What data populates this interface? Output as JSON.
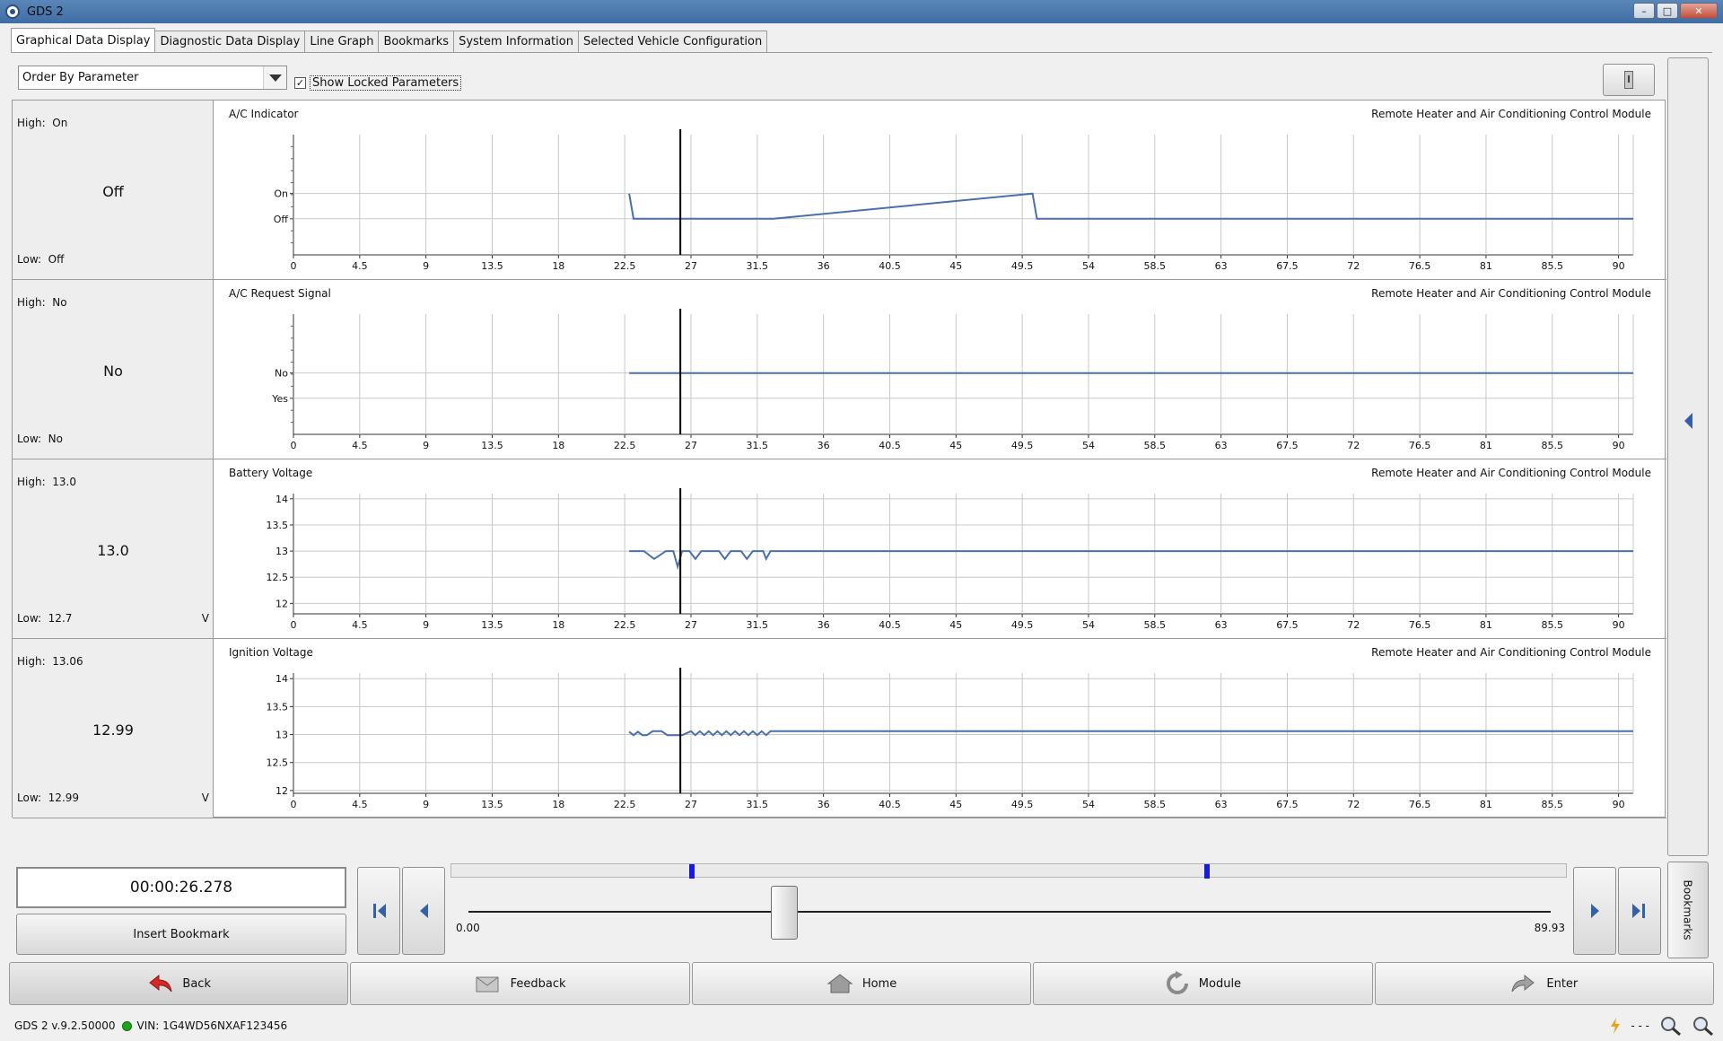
{
  "window": {
    "title": "GDS 2"
  },
  "tabs": [
    {
      "label": "Graphical Data Display",
      "active": true
    },
    {
      "label": "Diagnostic Data Display",
      "active": false
    },
    {
      "label": "Line Graph",
      "active": false
    },
    {
      "label": "Bookmarks",
      "active": false
    },
    {
      "label": "System Information",
      "active": false
    },
    {
      "label": "Selected Vehicle Configuration",
      "active": false
    }
  ],
  "toolbar": {
    "order_select": "Order By Parameter",
    "show_locked_checked": true,
    "show_locked_label": "Show Locked Parameters"
  },
  "x_axis": {
    "ticks": [
      "0",
      "4.5",
      "9",
      "13.5",
      "18",
      "22.5",
      "27",
      "31.5",
      "36",
      "40.5",
      "45",
      "49.5",
      "54",
      "58.5",
      "63",
      "67.5",
      "72",
      "76.5",
      "81",
      "85.5",
      "90"
    ],
    "min": 0,
    "max": 91,
    "cursor": 26.278
  },
  "rows": [
    {
      "name": "A/C Indicator",
      "module": "Remote Heater and Air Conditioning Control Module",
      "high_label": "High:",
      "high": "On",
      "current": "Off",
      "low_label": "Low:",
      "low": "Off",
      "unit": ""
    },
    {
      "name": "A/C Request Signal",
      "module": "Remote Heater and Air Conditioning Control Module",
      "high_label": "High:",
      "high": "No",
      "current": "No",
      "low_label": "Low:",
      "low": "No",
      "unit": ""
    },
    {
      "name": "Battery Voltage",
      "module": "Remote Heater and Air Conditioning Control Module",
      "high_label": "High:",
      "high": "13.0",
      "current": "13.0",
      "low_label": "Low:",
      "low": "12.7",
      "unit": "V"
    },
    {
      "name": "Ignition Voltage",
      "module": "Remote Heater and Air Conditioning Control Module",
      "high_label": "High:",
      "high": "13.06",
      "current": "12.99",
      "low_label": "Low:",
      "low": "12.99",
      "unit": "V"
    }
  ],
  "chart_data": [
    {
      "type": "line",
      "title": "A/C Indicator",
      "y_categories": [
        "On",
        "Off"
      ],
      "series": [
        {
          "color": "#4a6fae",
          "x": [
            22.8,
            23.1,
            32.6,
            50.2,
            50.5,
            91
          ],
          "y": [
            "On",
            "Off",
            "Off",
            "On",
            "Off",
            "Off"
          ]
        }
      ],
      "grid": true
    },
    {
      "type": "line",
      "title": "A/C Request Signal",
      "y_categories": [
        "No",
        "Yes"
      ],
      "series": [
        {
          "color": "#4a6fae",
          "x": [
            22.8,
            91
          ],
          "y": [
            "No",
            "No"
          ]
        }
      ],
      "grid": true
    },
    {
      "type": "line",
      "title": "Battery Voltage",
      "ylim": [
        11.8,
        14.1
      ],
      "y_ticks": [
        "14",
        "13.5",
        "13",
        "12.5",
        "12"
      ],
      "series": [
        {
          "color": "#4a6fae",
          "x": [
            22.8,
            23.8,
            24.5,
            25.3,
            25.8,
            26.1,
            26.4,
            26.9,
            27.3,
            27.7,
            28.9,
            29.3,
            29.7,
            30.4,
            30.8,
            31.2,
            31.9,
            32.1,
            32.4,
            91
          ],
          "y": [
            13,
            13,
            12.85,
            13,
            13,
            12.7,
            13,
            13,
            12.85,
            13,
            13,
            12.85,
            13,
            13,
            12.85,
            13,
            13,
            12.85,
            13,
            13
          ]
        }
      ],
      "grid": true
    },
    {
      "type": "line",
      "title": "Ignition Voltage",
      "ylim": [
        11.95,
        14.1
      ],
      "y_ticks": [
        "14",
        "13.5",
        "13",
        "12.5",
        "12"
      ],
      "series": [
        {
          "color": "#4a6fae",
          "x": [
            22.8,
            23.1,
            23.4,
            23.7,
            24.0,
            24.4,
            25.0,
            25.4,
            25.8,
            26.4,
            27.0,
            27.3,
            27.6,
            27.9,
            28.2,
            28.5,
            28.8,
            29.1,
            29.4,
            29.7,
            30.0,
            30.3,
            30.6,
            30.9,
            31.2,
            31.5,
            31.8,
            32.1,
            32.4,
            91
          ],
          "y": [
            13.05,
            12.99,
            13.05,
            12.99,
            12.99,
            13.06,
            13.06,
            12.99,
            12.99,
            12.99,
            13.06,
            12.99,
            13.06,
            12.99,
            13.06,
            12.99,
            13.06,
            12.99,
            13.06,
            12.99,
            13.06,
            12.99,
            13.06,
            12.99,
            13.06,
            12.99,
            13.06,
            12.99,
            13.06,
            13.06
          ]
        }
      ],
      "grid": true
    }
  ],
  "playback": {
    "time": "00:00:26.278",
    "insert_bookmark": "Insert Bookmark",
    "slider_min": "0.00",
    "slider_max": "89.93",
    "slider_value": 26.278,
    "bookmarks_tab": "Bookmarks",
    "bookmark_markers": [
      18.5,
      61.3
    ]
  },
  "bottom_buttons": [
    {
      "label": "Back",
      "icon": "back-arrow-icon"
    },
    {
      "label": "Feedback",
      "icon": "feedback-icon"
    },
    {
      "label": "Home",
      "icon": "home-icon"
    },
    {
      "label": "Module",
      "icon": "refresh-icon"
    },
    {
      "label": "Enter",
      "icon": "enter-arrow-icon"
    }
  ],
  "status": {
    "version": "GDS 2 v.9.2.50000",
    "vin": "VIN: 1G4WD56NXAF123456",
    "signal": "- - -"
  }
}
